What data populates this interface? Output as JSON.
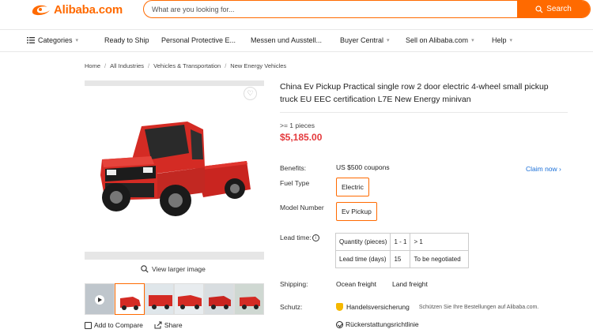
{
  "header": {
    "logo_text": "Alibaba.com",
    "search_placeholder": "What are you looking for...",
    "search_button": "Search"
  },
  "nav": {
    "categories": "Categories",
    "items": [
      "Ready to Ship",
      "Personal Protective E...",
      "Messen und Ausstell...",
      "Buyer Central",
      "Sell on Alibaba.com",
      "Help"
    ]
  },
  "breadcrumb": [
    "Home",
    "All Industries",
    "Vehicles & Transportation",
    "New Energy Vehicles"
  ],
  "gallery": {
    "view_larger": "View larger image",
    "add_to_compare": "Add to Compare",
    "share": "Share"
  },
  "product": {
    "title": "China Ev Pickup Practical single row 2 door electric 4-wheel small pickup truck EU EEC certification L7E New Energy minivan",
    "moq": ">= 1 pieces",
    "price": "$5,185.00",
    "benefits_label": "Benefits:",
    "benefits_value": "US $500 coupons",
    "claim_now": "Claim now ›",
    "fuel_type_label": "Fuel Type",
    "fuel_type_value": "Electric",
    "model_label": "Model Number",
    "model_value": "Ev Pickup",
    "lead_time_label": "Lead time:",
    "lead_table": {
      "row1": [
        "Quantity (pieces)",
        "1 - 1",
        "> 1"
      ],
      "row2": [
        "Lead time (days)",
        "15",
        "To be negotiated"
      ]
    },
    "shipping_label": "Shipping:",
    "shipping_options": [
      "Ocean freight",
      "Land freight"
    ],
    "schutz_label": "Schutz:",
    "schutz_value": "Handelsversicherung",
    "schutz_note": "Schützen Sie Ihre Bestellungen auf Alibaba.com.",
    "refund": "Rückerstattungsrichtlinie"
  },
  "colors": {
    "accent": "#ff6a00",
    "price": "#e4393c",
    "link": "#1a6fd8",
    "truck": "#d42b24"
  }
}
